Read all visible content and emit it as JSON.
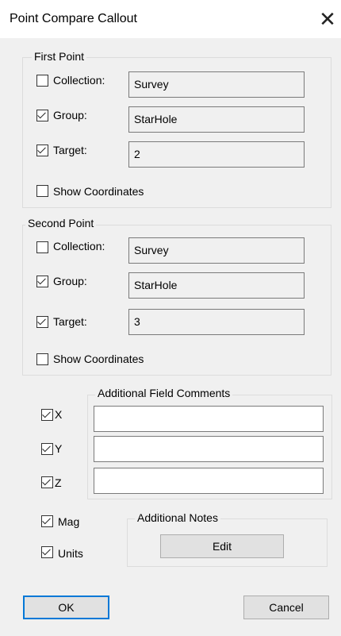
{
  "dialog": {
    "title": "Point Compare Callout"
  },
  "first_point": {
    "label": "First Point",
    "collection": {
      "label": "Collection:",
      "checked": false,
      "value": "Survey"
    },
    "group": {
      "label": "Group:",
      "checked": true,
      "value": "StarHole"
    },
    "target": {
      "label": "Target:",
      "checked": true,
      "value": "2"
    },
    "show_coordinates": {
      "label": "Show Coordinates",
      "checked": false
    }
  },
  "second_point": {
    "label": "Second Point",
    "collection": {
      "label": "Collection:",
      "checked": false,
      "value": "Survey"
    },
    "group": {
      "label": "Group:",
      "checked": true,
      "value": "StarHole"
    },
    "target": {
      "label": "Target:",
      "checked": true,
      "value": "3"
    },
    "show_coordinates": {
      "label": "Show Coordinates",
      "checked": false
    }
  },
  "fields": {
    "x": {
      "label": "X",
      "checked": true
    },
    "y": {
      "label": "Y",
      "checked": true
    },
    "z": {
      "label": "Z",
      "checked": true
    },
    "mag": {
      "label": "Mag",
      "checked": true
    },
    "units": {
      "label": "Units",
      "checked": true
    }
  },
  "additional_field_comments": {
    "label": "Additional Field Comments",
    "x": "",
    "y": "",
    "z": ""
  },
  "additional_notes": {
    "label": "Additional Notes",
    "edit_label": "Edit"
  },
  "buttons": {
    "ok": "OK",
    "cancel": "Cancel"
  }
}
